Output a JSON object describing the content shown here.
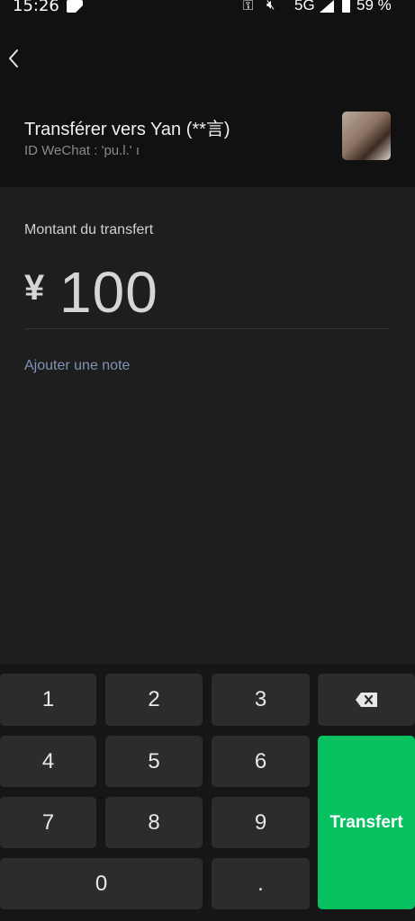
{
  "status_bar": {
    "time": "15:26",
    "network": "5G",
    "battery": "59 %"
  },
  "header": {
    "back_icon": "chevron-left-icon",
    "title": "Transférer vers Yan (**言)",
    "wechat_id": "ID WeChat : 'pu.l.'  ı"
  },
  "transfer": {
    "amount_label": "Montant du transfert",
    "currency": "¥",
    "amount": "100",
    "add_note": "Ajouter une note"
  },
  "keypad": {
    "keys": {
      "k1": "1",
      "k2": "2",
      "k3": "3",
      "k4": "4",
      "k5": "5",
      "k6": "6",
      "k7": "7",
      "k8": "8",
      "k9": "9",
      "k0": "0",
      "dot": "."
    },
    "backspace_icon": "backspace-icon",
    "transfer_label": "Transfert"
  },
  "colors": {
    "accent": "#07c160",
    "link": "#7f93b4"
  }
}
